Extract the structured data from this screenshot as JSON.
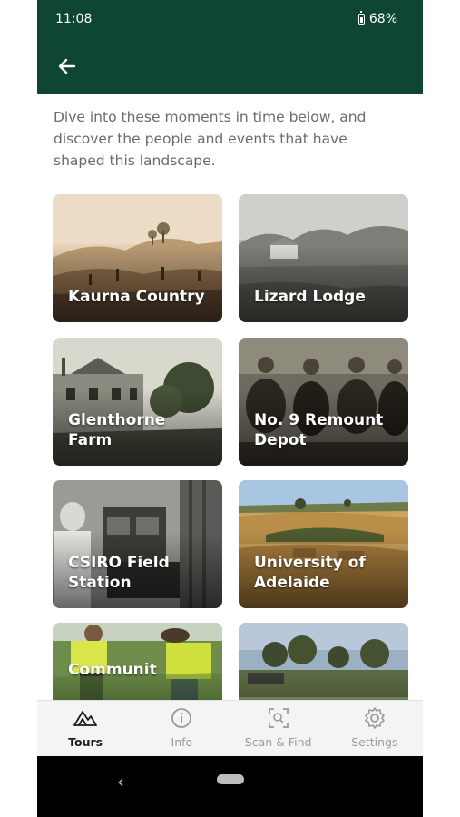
{
  "status": {
    "time": "11:08",
    "battery": "68%"
  },
  "header": {
    "back_icon": "arrow-left-icon"
  },
  "intro": "Dive into these moments in time below, and discover the people and events that have shaped this landscape.",
  "cards": [
    {
      "title": "Kaurna Country"
    },
    {
      "title": "Lizard Lodge"
    },
    {
      "title": "Glenthorne Farm"
    },
    {
      "title": "No. 9 Remount Depot"
    },
    {
      "title": "CSIRO Field Station"
    },
    {
      "title": "University of Adelaide"
    },
    {
      "title": "Communit"
    },
    {
      "title": ""
    }
  ],
  "nav": [
    {
      "label": "Tours",
      "icon": "mountains-icon",
      "active": true
    },
    {
      "label": "Info",
      "icon": "info-icon",
      "active": false
    },
    {
      "label": "Scan & Find",
      "icon": "scan-icon",
      "active": false
    },
    {
      "label": "Settings",
      "icon": "gear-icon",
      "active": false
    }
  ],
  "colors": {
    "header": "#0e4631",
    "intro_text": "#6b6b6b",
    "nav_bg": "#f4f4f4"
  }
}
